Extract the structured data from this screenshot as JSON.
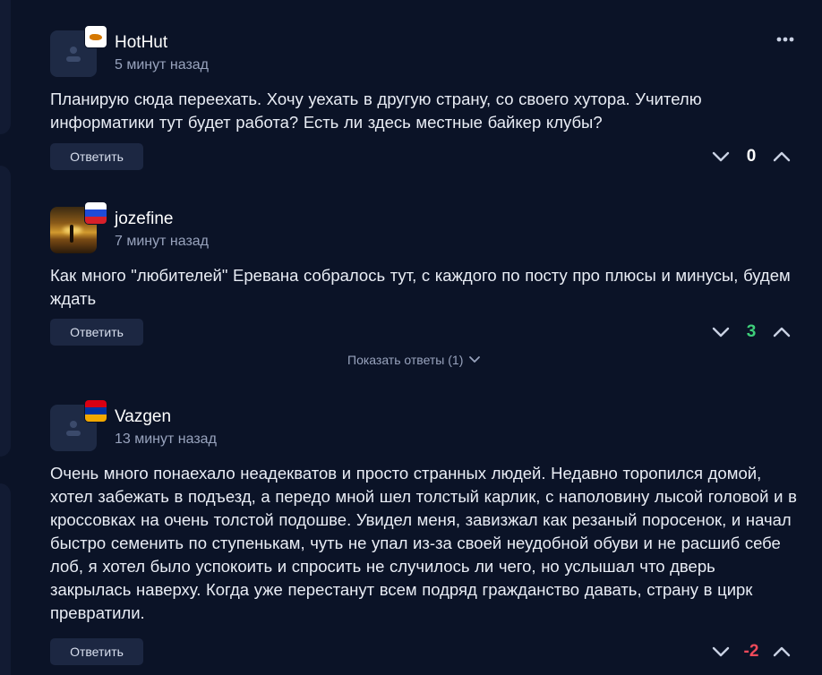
{
  "comments": [
    {
      "username": "HotHut",
      "time": "5 минут назад",
      "flag": "cyprus",
      "text": "Планирую сюда переехать. Хочу уехать в другую страну, со своего хутора. Учителю информатики тут будет работа? Есть ли здесь местные байкер клубы?",
      "reply_label": "Ответить",
      "score": "0",
      "score_color": "#ffffff"
    },
    {
      "username": "jozefine",
      "time": "7 минут назад",
      "flag": "russia",
      "text": "Как много \"любителей\" Еревана собралось тут, с каждого по посту про плюсы и минусы, будем ждать",
      "reply_label": "Ответить",
      "score": "3",
      "score_color": "#3ecf7a"
    },
    {
      "username": "Vazgen",
      "time": "13 минут назад",
      "flag": "armenia",
      "text": "Очень много понаехало неадекватов и просто странных людей. Недавно торопился домой, хотел забежать в подъезд, а передо мной шел толстый карлик, с наполовину лысой головой и в кроссовках на очень толстой подошве. Увидел меня, завизжал как резаный поросенок, и начал быстро семенить по ступенькам, чуть не упал из-за своей неудобной обуви и не расшиб себе лоб, я хотел было успокоить и спросить не случилось ли чего, но услышал что дверь закрылась наверху.  Когда уже перестанут всем подряд гражданство давать, страну в цирк превратили.",
      "reply_label": "Ответить",
      "score": "-2",
      "score_color": "#ef4a5a"
    }
  ],
  "show_replies_label": "Показать ответы (1)",
  "icons": {
    "more": "more-dots-icon",
    "vote_down": "chevron-down-icon",
    "vote_up": "chevron-up-icon",
    "avatar_placeholder": "user-icon"
  },
  "colors": {
    "background": "#0b1327",
    "button": "#1c2742",
    "muted_text": "#98a3bd"
  }
}
